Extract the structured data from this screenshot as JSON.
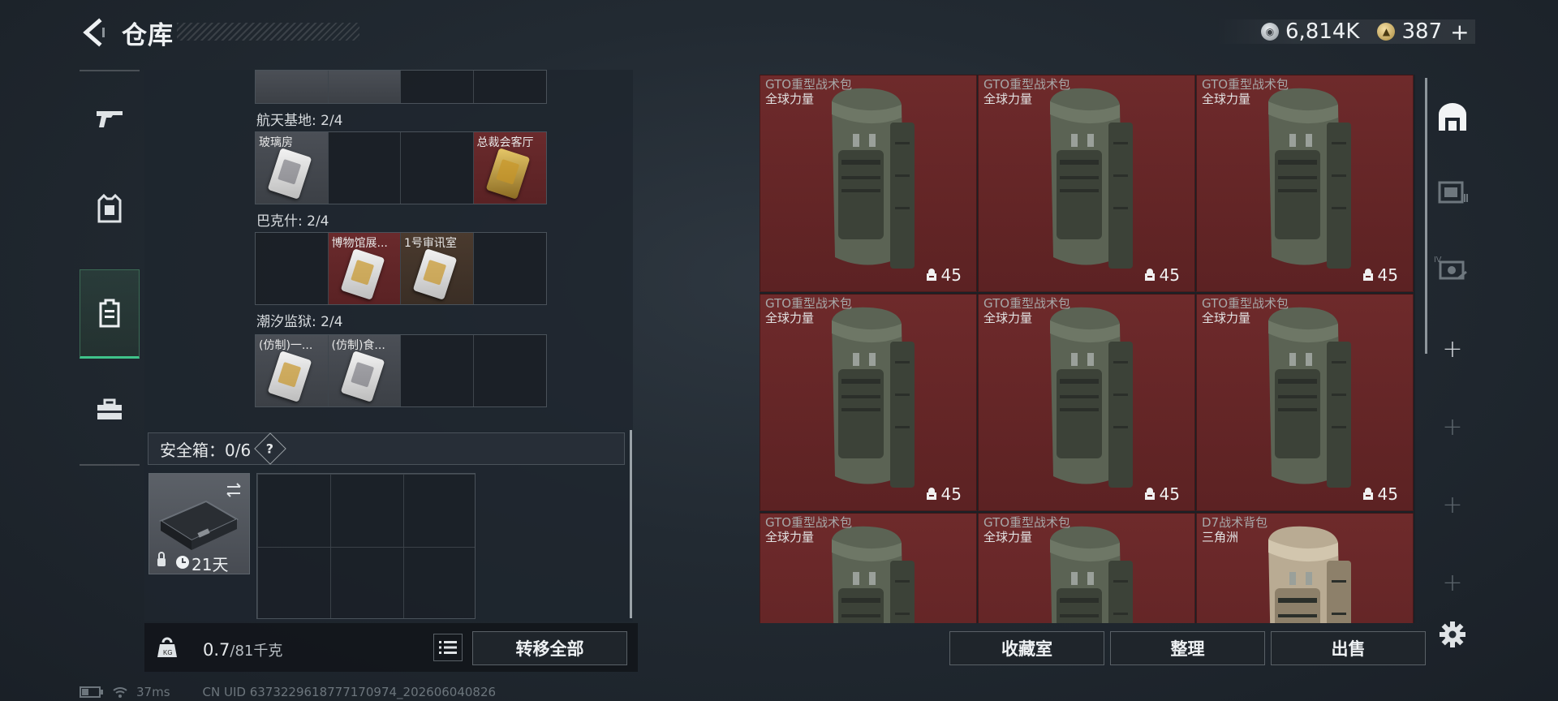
{
  "header": {
    "title": "仓库",
    "currency_silver": "6,814K",
    "currency_gold": "387",
    "add_label": "+"
  },
  "left_sidebar": {
    "items": [
      "weapon",
      "armor",
      "backpack",
      "toolbox"
    ],
    "active": "backpack"
  },
  "inventory": {
    "categories": [
      {
        "label": "航天基地: 2/4",
        "slots": [
          "玻璃房",
          "",
          "",
          "总裁会客厅"
        ]
      },
      {
        "label": "巴克什: 2/4",
        "slots": [
          "",
          "博物馆展...",
          "1号审讯室",
          ""
        ]
      },
      {
        "label": "潮汐监狱: 2/4",
        "slots": [
          "(仿制)一...",
          "(仿制)食...",
          "",
          ""
        ]
      }
    ],
    "safe_box": {
      "label": "安全箱：0/6",
      "help": "?",
      "timer": "21天"
    },
    "weight": {
      "current": "0.7",
      "max": "/81千克"
    },
    "transfer_all": "转移全部"
  },
  "grid": {
    "items": [
      {
        "name": "GTO重型战术包",
        "brand": "全球力量",
        "qty": "45"
      },
      {
        "name": "GTO重型战术包",
        "brand": "全球力量",
        "qty": "45"
      },
      {
        "name": "GTO重型战术包",
        "brand": "全球力量",
        "qty": "45"
      },
      {
        "name": "GTO重型战术包",
        "brand": "全球力量",
        "qty": "45"
      },
      {
        "name": "GTO重型战术包",
        "brand": "全球力量",
        "qty": "45"
      },
      {
        "name": "GTO重型战术包",
        "brand": "全球力量",
        "qty": "45"
      },
      {
        "name": "GTO重型战术包",
        "brand": "全球力量",
        "qty": ""
      },
      {
        "name": "GTO重型战术包",
        "brand": "全球力量",
        "qty": ""
      },
      {
        "name": "D7战术背包",
        "brand": "三角洲",
        "qty": ""
      }
    ],
    "buttons": {
      "collection": "收藏室",
      "sort": "整理",
      "sell": "出售"
    }
  },
  "right_sidebar": {
    "tab_roman": "IV"
  },
  "status": {
    "ping": "37ms",
    "uid": "CN UID 6373229618777170974_202606040826"
  },
  "colors": {
    "accent_green": "#3fc38a",
    "item_red": "#6e2a2b",
    "panel": "#1e262e"
  }
}
